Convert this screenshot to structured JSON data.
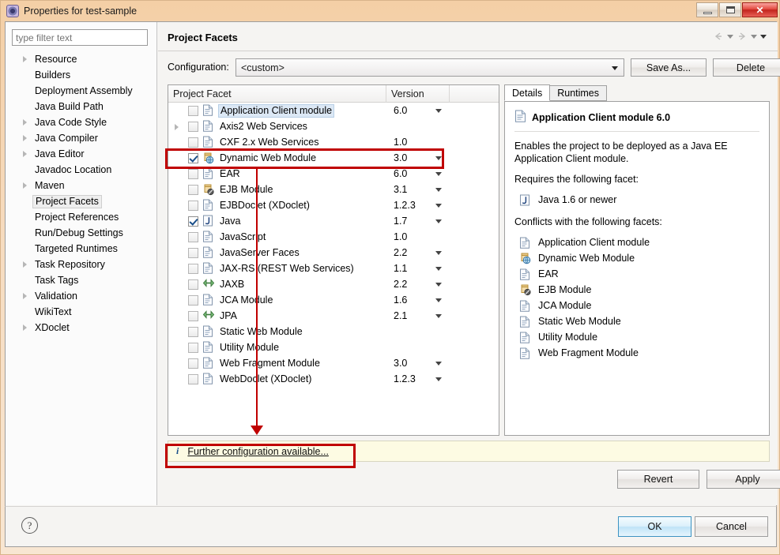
{
  "window": {
    "title": "Properties for test-sample",
    "icon": "eclipse-properties-icon",
    "minimize_label": "",
    "maximize_label": "",
    "close_label": "✕"
  },
  "sidebar": {
    "filter": {
      "value": "",
      "placeholder": "type filter text"
    },
    "items": [
      {
        "label": "Resource",
        "expandable": true,
        "selected": false
      },
      {
        "label": "Builders",
        "expandable": false,
        "selected": false
      },
      {
        "label": "Deployment Assembly",
        "expandable": false,
        "selected": false
      },
      {
        "label": "Java Build Path",
        "expandable": false,
        "selected": false
      },
      {
        "label": "Java Code Style",
        "expandable": true,
        "selected": false
      },
      {
        "label": "Java Compiler",
        "expandable": true,
        "selected": false
      },
      {
        "label": "Java Editor",
        "expandable": true,
        "selected": false
      },
      {
        "label": "Javadoc Location",
        "expandable": false,
        "selected": false
      },
      {
        "label": "Maven",
        "expandable": true,
        "selected": false
      },
      {
        "label": "Project Facets",
        "expandable": false,
        "selected": true
      },
      {
        "label": "Project References",
        "expandable": false,
        "selected": false
      },
      {
        "label": "Run/Debug Settings",
        "expandable": false,
        "selected": false
      },
      {
        "label": "Targeted Runtimes",
        "expandable": false,
        "selected": false
      },
      {
        "label": "Task Repository",
        "expandable": true,
        "selected": false
      },
      {
        "label": "Task Tags",
        "expandable": false,
        "selected": false
      },
      {
        "label": "Validation",
        "expandable": true,
        "selected": false
      },
      {
        "label": "WikiText",
        "expandable": false,
        "selected": false
      },
      {
        "label": "XDoclet",
        "expandable": true,
        "selected": false
      }
    ]
  },
  "page": {
    "title": "Project Facets",
    "nav": {
      "back_icon": "back-arrow-icon",
      "back_menu_icon": "chevron-down-icon",
      "forward_icon": "forward-arrow-icon",
      "forward_menu_icon": "chevron-down-icon",
      "view_menu_icon": "chevron-down-icon"
    }
  },
  "configuration": {
    "label": "Configuration:",
    "value": "<custom>",
    "save_as_label": "Save As...",
    "delete_label": "Delete"
  },
  "facet_table": {
    "columns": [
      "Project Facet",
      "Version",
      ""
    ],
    "rows": [
      {
        "name": "Application Client module",
        "version": "6.0",
        "checked": false,
        "expandable": false,
        "has_version_caret": true,
        "icon": "document-facet-icon",
        "highlighted": true
      },
      {
        "name": "Axis2 Web Services",
        "version": "",
        "checked": false,
        "expandable": true,
        "has_version_caret": false,
        "icon": "document-facet-icon",
        "highlighted": false
      },
      {
        "name": "CXF 2.x Web Services",
        "version": "1.0",
        "checked": false,
        "expandable": false,
        "has_version_caret": false,
        "icon": "document-facet-icon",
        "highlighted": false
      },
      {
        "name": "Dynamic Web Module",
        "version": "3.0",
        "checked": true,
        "expandable": false,
        "has_version_caret": true,
        "icon": "web-module-icon",
        "highlighted": false
      },
      {
        "name": "EAR",
        "version": "6.0",
        "checked": false,
        "expandable": false,
        "has_version_caret": true,
        "icon": "document-facet-icon",
        "highlighted": false
      },
      {
        "name": "EJB Module",
        "version": "3.1",
        "checked": false,
        "expandable": false,
        "has_version_caret": true,
        "icon": "ejb-module-icon",
        "highlighted": false
      },
      {
        "name": "EJBDoclet (XDoclet)",
        "version": "1.2.3",
        "checked": false,
        "expandable": false,
        "has_version_caret": true,
        "icon": "document-facet-icon",
        "highlighted": false
      },
      {
        "name": "Java",
        "version": "1.7",
        "checked": true,
        "expandable": false,
        "has_version_caret": true,
        "icon": "java-facet-icon",
        "highlighted": false
      },
      {
        "name": "JavaScript",
        "version": "1.0",
        "checked": false,
        "expandable": false,
        "has_version_caret": false,
        "icon": "document-facet-icon",
        "highlighted": false
      },
      {
        "name": "JavaServer Faces",
        "version": "2.2",
        "checked": false,
        "expandable": false,
        "has_version_caret": true,
        "icon": "document-facet-icon",
        "highlighted": false
      },
      {
        "name": "JAX-RS (REST Web Services)",
        "version": "1.1",
        "checked": false,
        "expandable": false,
        "has_version_caret": true,
        "icon": "document-facet-icon",
        "highlighted": false
      },
      {
        "name": "JAXB",
        "version": "2.2",
        "checked": false,
        "expandable": false,
        "has_version_caret": true,
        "icon": "jaxb-arrows-icon",
        "highlighted": false
      },
      {
        "name": "JCA Module",
        "version": "1.6",
        "checked": false,
        "expandable": false,
        "has_version_caret": true,
        "icon": "document-facet-icon",
        "highlighted": false
      },
      {
        "name": "JPA",
        "version": "2.1",
        "checked": false,
        "expandable": false,
        "has_version_caret": true,
        "icon": "jaxb-arrows-icon",
        "highlighted": false
      },
      {
        "name": "Static Web Module",
        "version": "",
        "checked": false,
        "expandable": false,
        "has_version_caret": false,
        "icon": "document-facet-icon",
        "highlighted": false
      },
      {
        "name": "Utility Module",
        "version": "",
        "checked": false,
        "expandable": false,
        "has_version_caret": false,
        "icon": "document-facet-icon",
        "highlighted": false
      },
      {
        "name": "Web Fragment Module",
        "version": "3.0",
        "checked": false,
        "expandable": false,
        "has_version_caret": true,
        "icon": "document-facet-icon",
        "highlighted": false
      },
      {
        "name": "WebDoclet (XDoclet)",
        "version": "1.2.3",
        "checked": false,
        "expandable": false,
        "has_version_caret": true,
        "icon": "document-facet-icon",
        "highlighted": false
      }
    ]
  },
  "details": {
    "tabs": [
      {
        "label": "Details",
        "active": true
      },
      {
        "label": "Runtimes",
        "active": false
      }
    ],
    "header_title": "Application Client module 6.0",
    "header_icon": "document-facet-icon",
    "description": "Enables the project to be deployed as a Java EE Application Client module.",
    "requires_label": "Requires the following facet:",
    "requires": [
      {
        "label": "Java 1.6 or newer",
        "icon": "java-facet-icon"
      }
    ],
    "conflicts_label": "Conflicts with the following facets:",
    "conflicts": [
      {
        "label": "Application Client module",
        "icon": "document-facet-icon"
      },
      {
        "label": "Dynamic Web Module",
        "icon": "web-module-icon"
      },
      {
        "label": "EAR",
        "icon": "document-facet-icon"
      },
      {
        "label": "EJB Module",
        "icon": "ejb-module-icon"
      },
      {
        "label": "JCA Module",
        "icon": "document-facet-icon"
      },
      {
        "label": "Static Web Module",
        "icon": "document-facet-icon"
      },
      {
        "label": "Utility Module",
        "icon": "document-facet-icon"
      },
      {
        "label": "Web Fragment Module",
        "icon": "document-facet-icon"
      }
    ]
  },
  "info_bar": {
    "icon": "info-icon",
    "icon_glyph": "i",
    "link_label": "Further configuration available..."
  },
  "actions": {
    "revert_label": "Revert",
    "apply_label": "Apply",
    "ok_label": "OK",
    "cancel_label": "Cancel",
    "help_icon": "help-icon",
    "help_glyph": "?"
  },
  "annotations": {
    "highlight_color": "#c00000",
    "boxes": [
      "dynamic-web-module-row",
      "further-configuration-link"
    ],
    "arrow": "pointer-from-row-to-link"
  }
}
